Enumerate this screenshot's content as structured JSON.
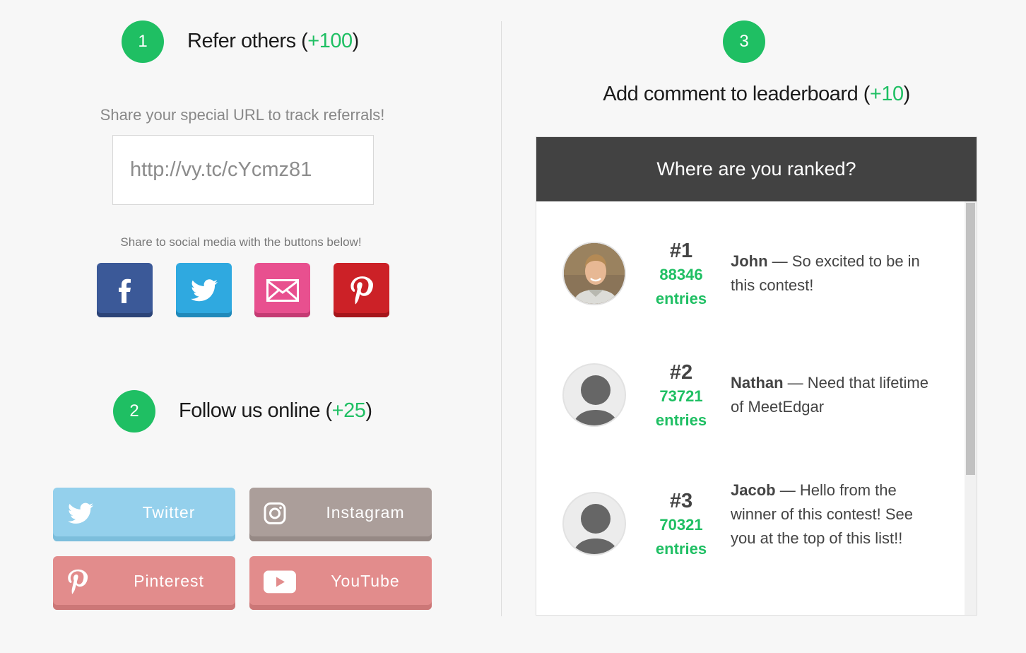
{
  "steps": {
    "refer": {
      "number": "1",
      "title": "Refer others (",
      "points": "+100",
      "close": ")"
    },
    "follow": {
      "number": "2",
      "title": "Follow us online (",
      "points": "+25",
      "close": ")"
    },
    "comment": {
      "number": "3",
      "title": "Add comment to leaderboard (",
      "points": "+10",
      "close": ")"
    }
  },
  "refer": {
    "share_hint": "Share your special URL to track referrals!",
    "url": "http://vy.tc/cYcmz81",
    "social_hint": "Share to social media with the buttons below!",
    "share_buttons": [
      {
        "name": "facebook",
        "icon": "facebook-icon",
        "color": "#3b5998"
      },
      {
        "name": "twitter",
        "icon": "twitter-icon",
        "color": "#2fa9e0"
      },
      {
        "name": "email",
        "icon": "envelope-icon",
        "color": "#e8508f"
      },
      {
        "name": "pinterest",
        "icon": "pinterest-icon",
        "color": "#cc2127"
      }
    ]
  },
  "follow": {
    "buttons": [
      {
        "label": "Twitter",
        "icon": "twitter-icon",
        "color": "#94d0ec"
      },
      {
        "label": "Instagram",
        "icon": "instagram-icon",
        "color": "#ab9e9a"
      },
      {
        "label": "Pinterest",
        "icon": "pinterest-icon",
        "color": "#e28c8c"
      },
      {
        "label": "YouTube",
        "icon": "youtube-icon",
        "color": "#e28c8c"
      }
    ]
  },
  "leaderboard": {
    "heading": "Where are you ranked?",
    "entries": [
      {
        "rank": "#1",
        "count": "88346",
        "unit": "entries",
        "name": "John",
        "comment": " — So excited to be in this contest!"
      },
      {
        "rank": "#2",
        "count": "73721",
        "unit": "entries",
        "name": "Nathan",
        "comment": " — Need that lifetime of MeetEdgar"
      },
      {
        "rank": "#3",
        "count": "70321",
        "unit": "entries",
        "name": "Jacob",
        "comment": " — Hello from the winner of this contest! See you at the top of this list!!"
      }
    ]
  },
  "colors": {
    "accent": "#1fbf63",
    "header_bg": "#424242"
  }
}
